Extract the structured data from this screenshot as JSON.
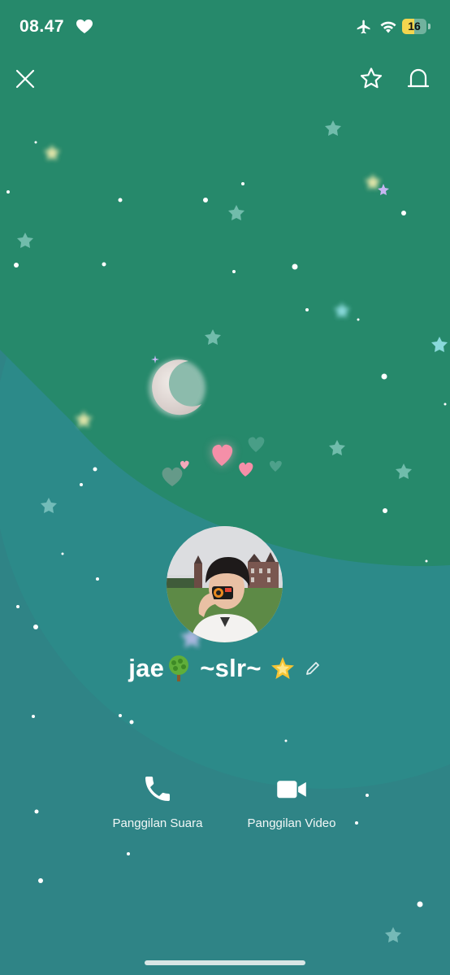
{
  "status_bar": {
    "time": "08.47",
    "battery_level": "16",
    "icons": [
      "heart-icon",
      "airplane-mode-icon",
      "wifi-icon",
      "battery-icon"
    ]
  },
  "toolbar": {
    "icons": [
      "close-icon",
      "star-icon",
      "bell-icon"
    ]
  },
  "profile": {
    "name_part1": "jae",
    "name_part2": "~slr~",
    "emojis": [
      "tree-emoji",
      "glowing-star-emoji"
    ],
    "edit_icon": "pencil-icon"
  },
  "actions": [
    {
      "label": "Panggilan Suara",
      "icon": "phone-icon"
    },
    {
      "label": "Panggilan Video",
      "icon": "video-camera-icon"
    }
  ],
  "colors": {
    "top_green": "#26896b",
    "bottom_teal": "#2f8486",
    "inner_teal": "#2c8b8a",
    "battery_fill": "#f3d54e",
    "heart_pink": "#f58fa8"
  }
}
